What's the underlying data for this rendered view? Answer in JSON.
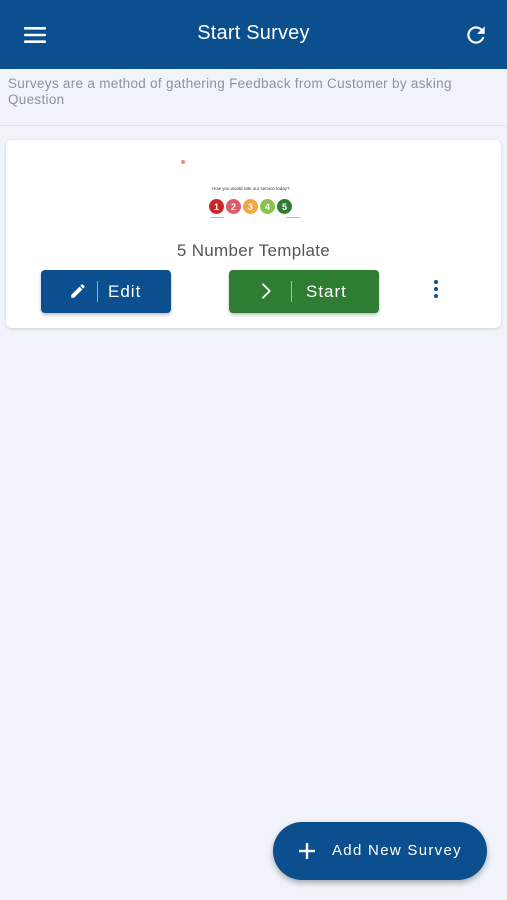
{
  "header": {
    "title": "Start Survey",
    "menu_icon": "hamburger-menu-icon",
    "refresh_icon": "refresh-icon",
    "background": "#0b4f8f"
  },
  "description": "Surveys are a method of gathering Feedback from Customer by asking Question",
  "surveys": [
    {
      "name": "5 Number Template",
      "thumbnail": {
        "question": "How you would rate our service today?",
        "ratings": [
          "1",
          "2",
          "3",
          "4",
          "5"
        ],
        "rating_colors": [
          "#c62828",
          "#e05a67",
          "#f4a640",
          "#8bc34a",
          "#2e7d32"
        ]
      },
      "edit_label": "Edit",
      "start_label": "Start",
      "edit_icon": "pencil-icon",
      "start_icon": "chevron-right-icon",
      "more_icon": "more-vertical-icon"
    }
  ],
  "fab": {
    "label": "Add New Survey",
    "icon": "plus-icon"
  },
  "colors": {
    "primary": "#0b4f8f",
    "success": "#2e7d32",
    "background": "#f0f4fa"
  }
}
